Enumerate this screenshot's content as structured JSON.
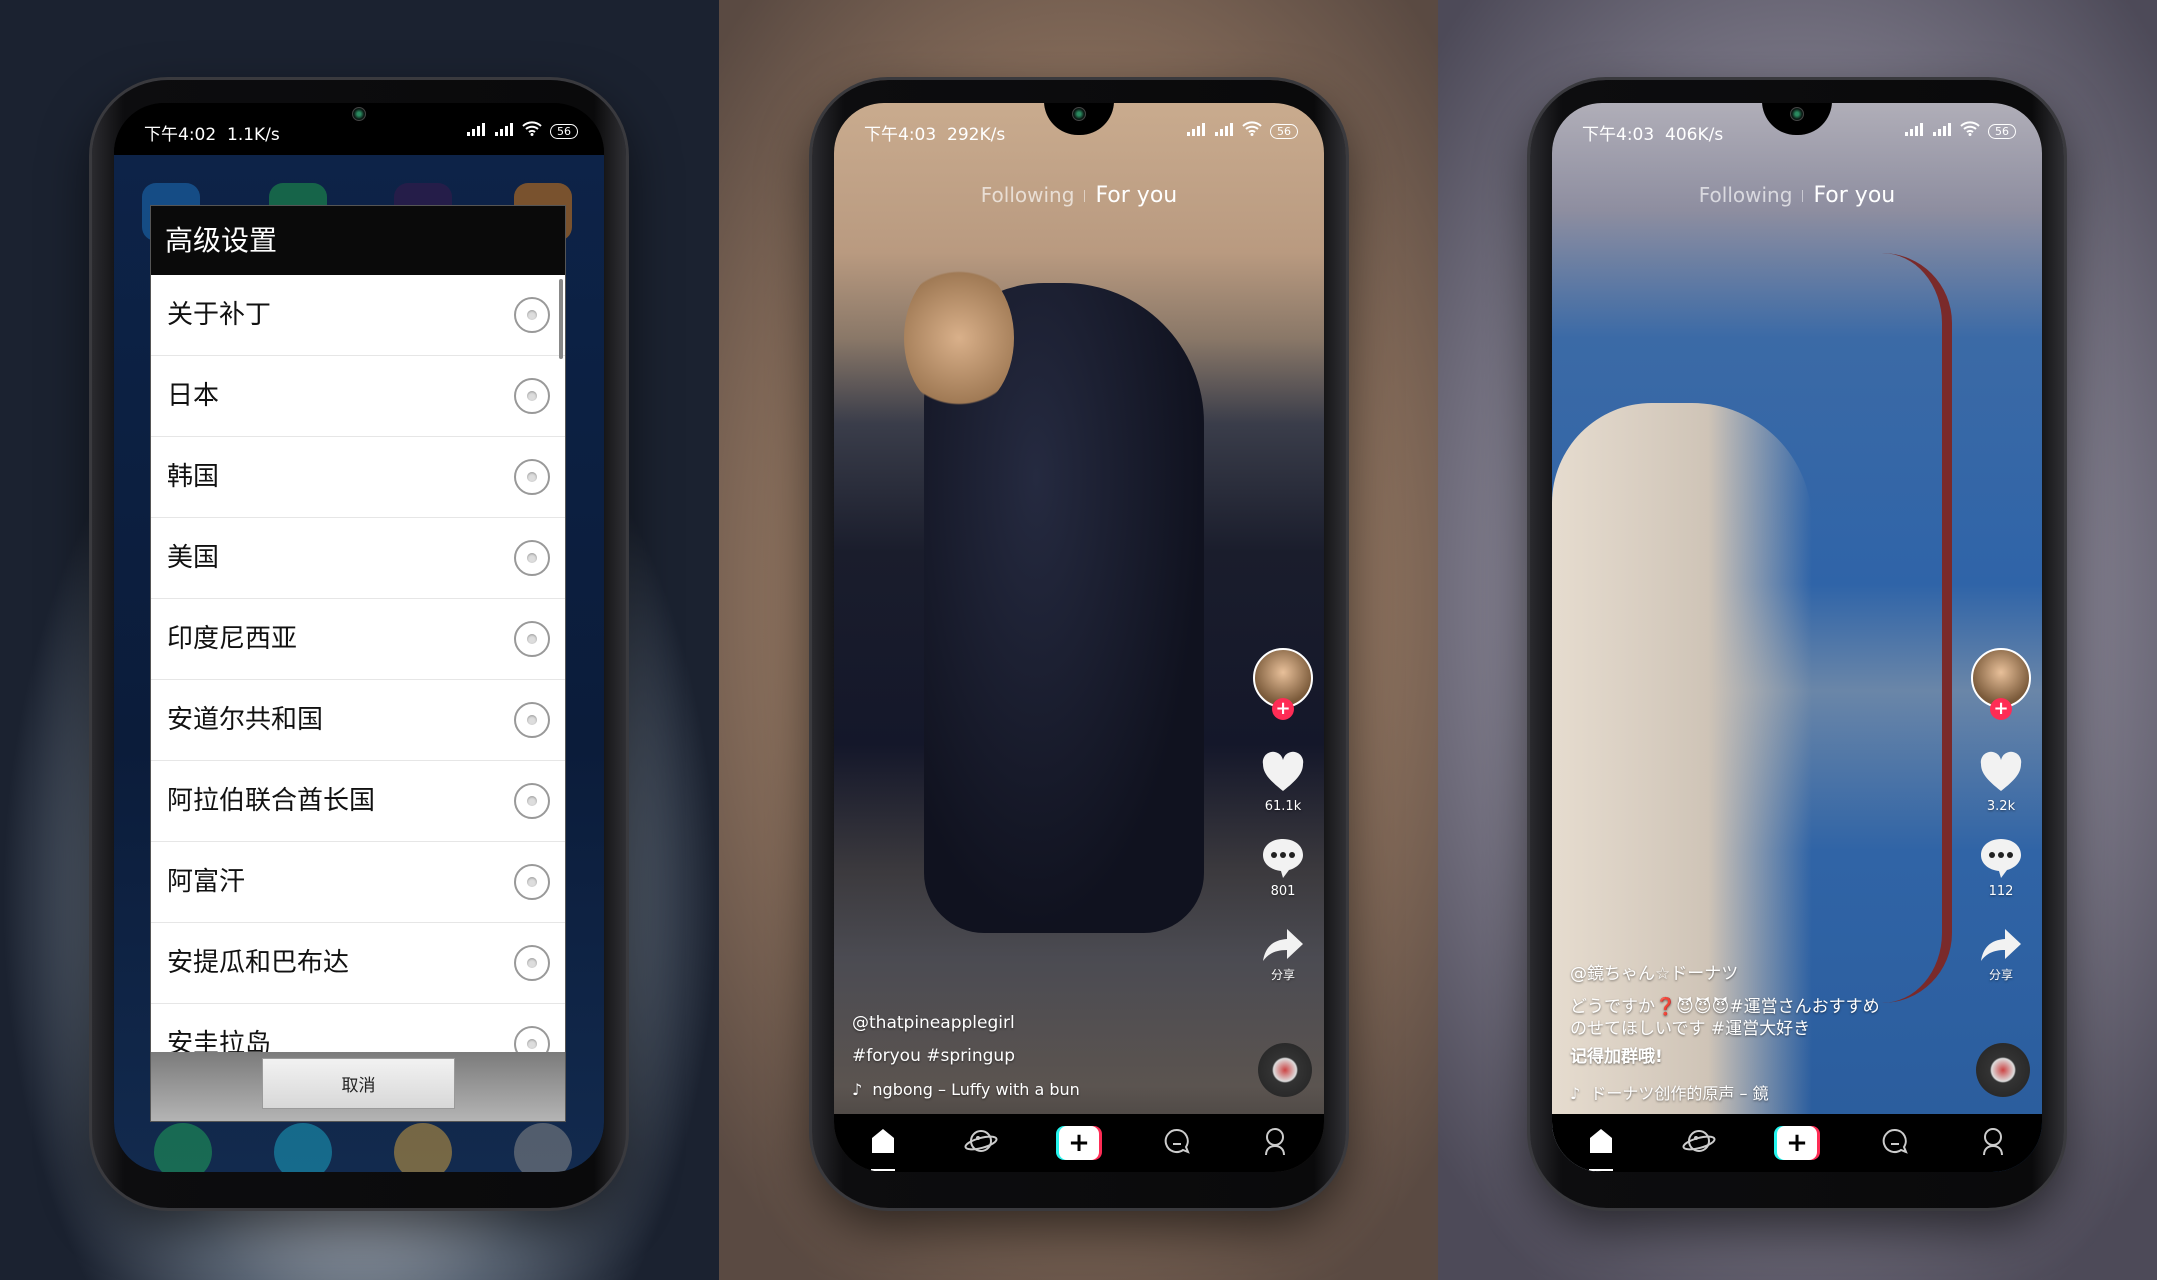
{
  "phones": [
    {
      "status": {
        "time": "下午4:02",
        "speed": "1.1K/s",
        "battery": "56"
      },
      "dialog": {
        "title": "高级设置",
        "items": [
          "关于补丁",
          "日本",
          "韩国",
          "美国",
          "印度尼西亚",
          "安道尔共和国",
          "阿拉伯联合酋长国",
          "阿富汗",
          "安提瓜和巴布达",
          "安圭拉岛"
        ],
        "selected": null,
        "cancel_label": "取消"
      }
    },
    {
      "status": {
        "time": "下午4:03",
        "speed": "292K/s",
        "battery": "56"
      },
      "tabs": [
        {
          "label": "Following",
          "active": false
        },
        {
          "label": "For you",
          "active": true
        }
      ],
      "side": {
        "likes": "61.1k",
        "comments": "801",
        "share_label": "分享"
      },
      "captions": [
        {
          "text": "@thatpineapplegirl",
          "bold": false
        },
        {
          "text": "#foryou #springup",
          "bold": false
        }
      ],
      "music": "ngbong – Luffy with a bun"
    },
    {
      "status": {
        "time": "下午4:03",
        "speed": "406K/s",
        "battery": "56"
      },
      "tabs": [
        {
          "label": "Following",
          "active": false
        },
        {
          "label": "For you",
          "active": true
        }
      ],
      "side": {
        "likes": "3.2k",
        "comments": "112",
        "share_label": "分享"
      },
      "captions": [
        {
          "text": "@鏡ちゃん☆ドーナツ",
          "bold": false
        },
        {
          "text": "どうですか❓😈😈😈#運営さんおすすめ",
          "bold": false
        },
        {
          "text": "のせてほしいです #運営大好き",
          "bold": false
        },
        {
          "text": "记得加群哦!",
          "bold": true
        }
      ],
      "music": "ドーナツ创作的原声 – 鏡"
    }
  ],
  "nav_icons": [
    "home-icon",
    "discover-icon",
    "create-icon",
    "inbox-icon",
    "profile-icon"
  ],
  "colors": {
    "accent_red": "#fe2c55",
    "accent_cyan": "#25f4ee"
  }
}
